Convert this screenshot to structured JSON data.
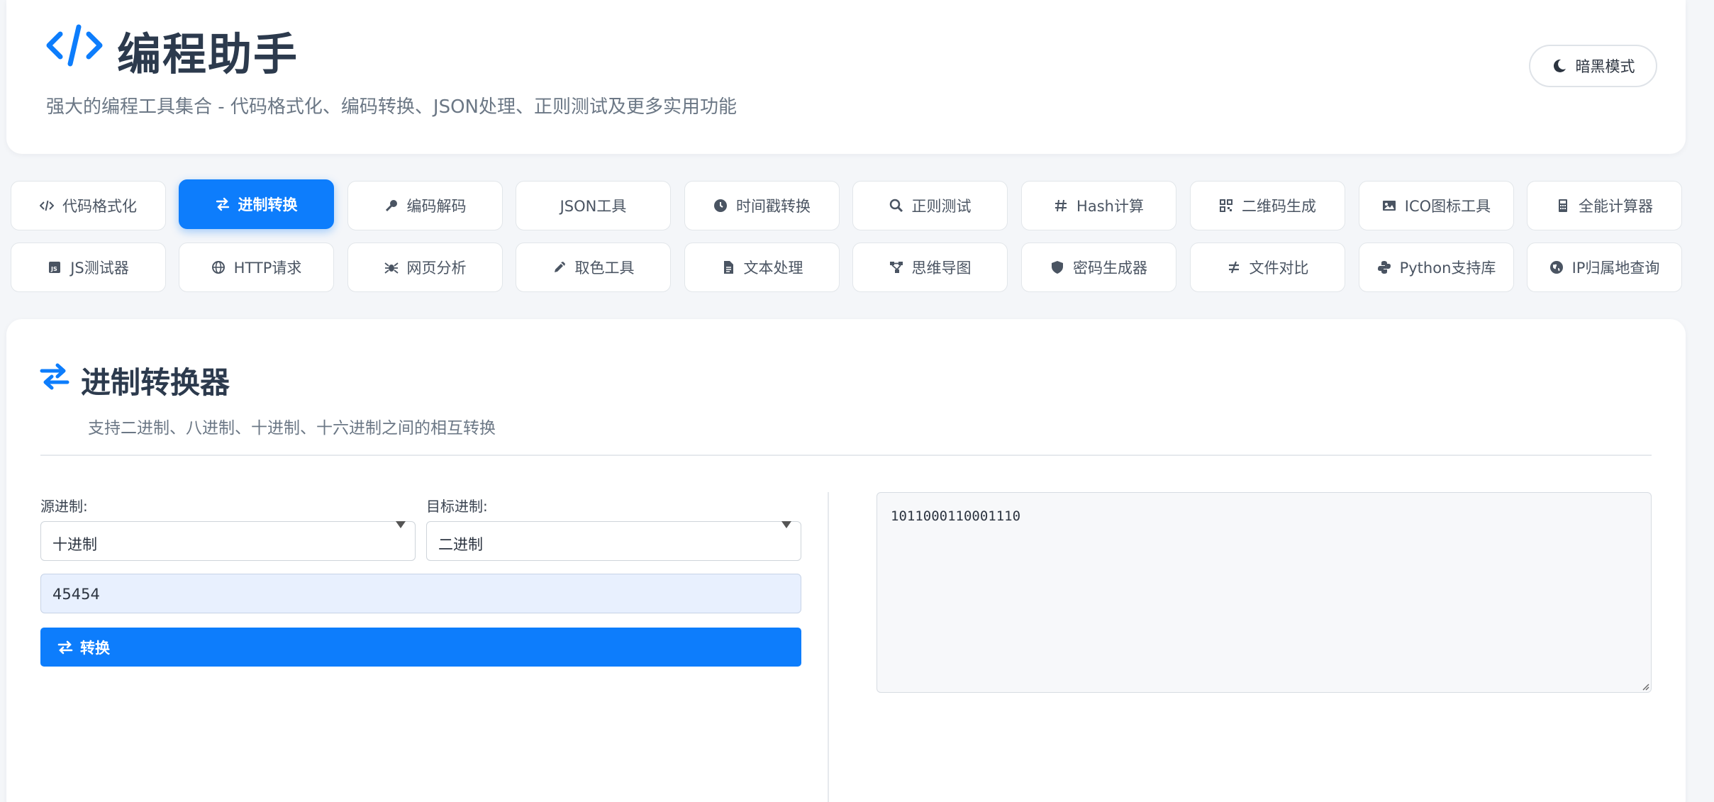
{
  "header": {
    "title": "编程助手",
    "subtitle": "强大的编程工具集合 - 代码格式化、编码转换、JSON处理、正则测试及更多实用功能",
    "dark_mode_label": "暗黑模式",
    "logo_icon": "code-icon"
  },
  "tabs": [
    {
      "label": "代码格式化",
      "icon": "code-icon"
    },
    {
      "label": "进制转换",
      "icon": "exchange-icon",
      "active": true
    },
    {
      "label": "编码解码",
      "icon": "key-icon"
    },
    {
      "label": "JSON工具",
      "icon": ""
    },
    {
      "label": "时间戳转换",
      "icon": "clock-icon"
    },
    {
      "label": "正则测试",
      "icon": "search-icon"
    },
    {
      "label": "Hash计算",
      "icon": "hash-icon"
    },
    {
      "label": "二维码生成",
      "icon": "qrcode-icon"
    },
    {
      "label": "ICO图标工具",
      "icon": "image-icon"
    },
    {
      "label": "全能计算器",
      "icon": "calculator-icon"
    },
    {
      "label": "JS测试器",
      "icon": "js-icon"
    },
    {
      "label": "HTTP请求",
      "icon": "globe-icon"
    },
    {
      "label": "网页分析",
      "icon": "spider-icon"
    },
    {
      "label": "取色工具",
      "icon": "eyedropper-icon"
    },
    {
      "label": "文本处理",
      "icon": "file-icon"
    },
    {
      "label": "思维导图",
      "icon": "sitemap-icon"
    },
    {
      "label": "密码生成器",
      "icon": "shield-icon"
    },
    {
      "label": "文件对比",
      "icon": "not-equal-icon"
    },
    {
      "label": "Python支持库",
      "icon": "python-icon"
    },
    {
      "label": "IP归属地查询",
      "icon": "globe-icon"
    }
  ],
  "tool": {
    "title": "进制转换器",
    "description": "支持二进制、八进制、十进制、十六进制之间的相互转换",
    "source_label": "源进制:",
    "source_value": "十进制",
    "target_label": "目标进制:",
    "target_value": "二进制",
    "input_value": "45454",
    "convert_label": "转换",
    "result": "1011000110001110"
  },
  "colors": {
    "accent": "#0d7dfc",
    "title": "#2c3a4d",
    "muted": "#6b7785",
    "background": "#f4f6f9"
  }
}
